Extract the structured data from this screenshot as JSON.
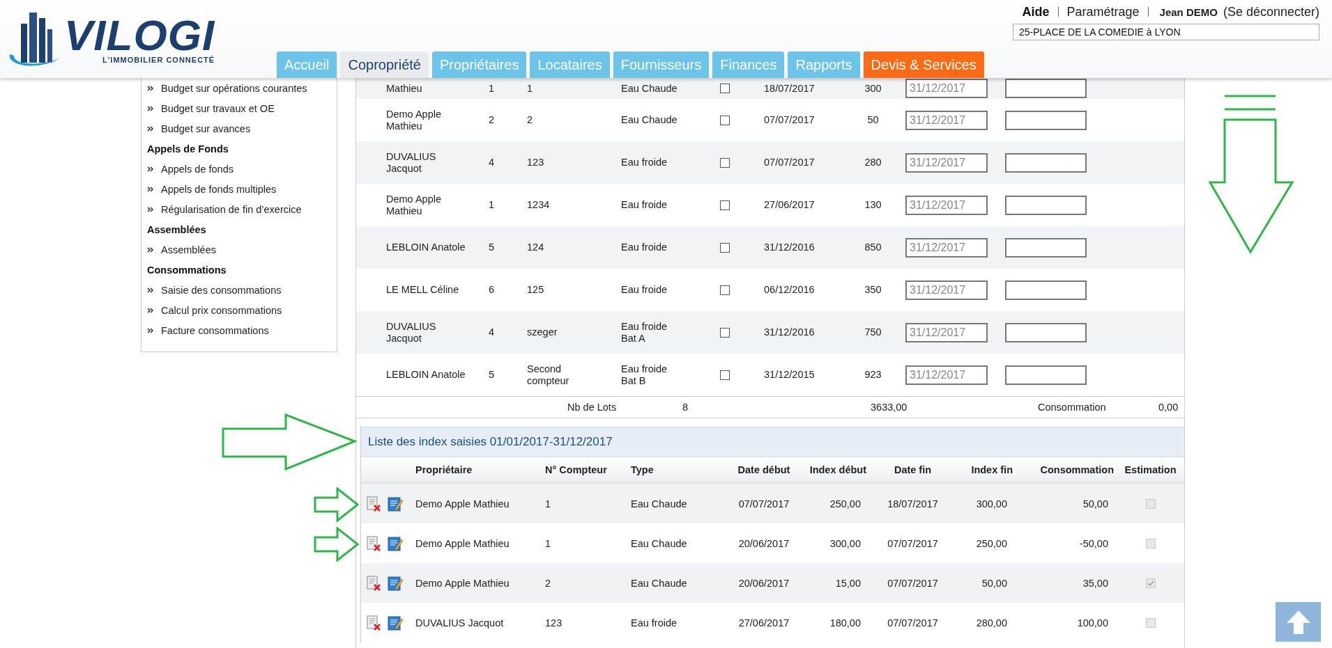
{
  "header": {
    "logo": {
      "name": "VILOGI",
      "tagline": "L'IMMOBILIER CONNECTÉ"
    },
    "links": [
      "Aide",
      "Paramétrage"
    ],
    "user": "Jean DEMO",
    "logout": "(Se déconnecter)",
    "address": "25-PLACE DE LA COMEDIE à LYON",
    "tabs": [
      {
        "label": "Accueil",
        "selected": false,
        "kind": "normal"
      },
      {
        "label": "Copropriété",
        "selected": true,
        "kind": "normal"
      },
      {
        "label": "Propriétaires",
        "selected": false,
        "kind": "normal"
      },
      {
        "label": "Locataires",
        "selected": false,
        "kind": "normal"
      },
      {
        "label": "Fournisseurs",
        "selected": false,
        "kind": "normal"
      },
      {
        "label": "Finances",
        "selected": false,
        "kind": "normal"
      },
      {
        "label": "Rapports",
        "selected": false,
        "kind": "normal"
      },
      {
        "label": "Devis & Services",
        "selected": false,
        "kind": "highlight"
      }
    ]
  },
  "sidebar": {
    "items": [
      {
        "kind": "link",
        "label": "Budget sur opérations courantes"
      },
      {
        "kind": "link",
        "label": "Budget sur travaux et OE"
      },
      {
        "kind": "link",
        "label": "Budget sur avances"
      },
      {
        "kind": "heading",
        "label": "Appels de Fonds"
      },
      {
        "kind": "link",
        "label": "Appels de fonds"
      },
      {
        "kind": "link",
        "label": "Appels de fonds multiples"
      },
      {
        "kind": "link",
        "label": "Régularisation de fin d’exercice"
      },
      {
        "kind": "heading",
        "label": "Assemblées"
      },
      {
        "kind": "link",
        "label": "Assemblées"
      },
      {
        "kind": "heading",
        "label": "Consommations"
      },
      {
        "kind": "link",
        "label": "Saisie des consommations"
      },
      {
        "kind": "link",
        "label": "Calcul prix consommations"
      },
      {
        "kind": "link",
        "label": "Facture consommations"
      }
    ]
  },
  "readings": {
    "rows": [
      {
        "name": "Mathieu",
        "lot": "1",
        "meter": "1",
        "type": "Eau Chaude",
        "checked": false,
        "date": "18/07/2017",
        "index": "300",
        "end_date_placeholder": "31/12/2017"
      },
      {
        "name": "Demo Apple\nMathieu",
        "lot": "2",
        "meter": "2",
        "type": "Eau Chaude",
        "checked": false,
        "date": "07/07/2017",
        "index": "50",
        "end_date_placeholder": "31/12/2017"
      },
      {
        "name": "DUVALIUS\nJacquot",
        "lot": "4",
        "meter": "123",
        "type": "Eau froide",
        "checked": false,
        "date": "07/07/2017",
        "index": "280",
        "end_date_placeholder": "31/12/2017"
      },
      {
        "name": "Demo Apple\nMathieu",
        "lot": "1",
        "meter": "1234",
        "type": "Eau froide",
        "checked": false,
        "date": "27/06/2017",
        "index": "130",
        "end_date_placeholder": "31/12/2017"
      },
      {
        "name": "LEBLOIN Anatole",
        "lot": "5",
        "meter": "124",
        "type": "Eau froide",
        "checked": false,
        "date": "31/12/2016",
        "index": "850",
        "end_date_placeholder": "31/12/2017"
      },
      {
        "name": "LE MELL Céline",
        "lot": "6",
        "meter": "125",
        "type": "Eau froide",
        "checked": false,
        "date": "06/12/2016",
        "index": "350",
        "end_date_placeholder": "31/12/2017"
      },
      {
        "name": "DUVALIUS\nJacquot",
        "lot": "4",
        "meter": "szeger",
        "type": "Eau froide\nBat A",
        "checked": false,
        "date": "31/12/2016",
        "index": "750",
        "end_date_placeholder": "31/12/2017"
      },
      {
        "name": "LEBLOIN Anatole",
        "lot": "5",
        "meter": "Second\ncompteur",
        "type": "Eau froide\nBat B",
        "checked": false,
        "date": "31/12/2015",
        "index": "923",
        "end_date_placeholder": "31/12/2017"
      }
    ],
    "footer": {
      "lots_label": "Nb de Lots",
      "lots": "8",
      "total": "3633,00",
      "consumption_label": "Consommation",
      "consumption": "0,00"
    }
  },
  "index_list": {
    "title": "Liste des index saisies 01/01/2017-31/12/2017",
    "columns": [
      "Propriétaire",
      "N° Compteur",
      "Type",
      "Date début",
      "Index début",
      "Date fin",
      "Index fin",
      "Consommation",
      "Estimation"
    ],
    "rows": [
      {
        "owner": "Demo Apple Mathieu",
        "meter": "1",
        "type": "Eau Chaude",
        "start_date": "07/07/2017",
        "start_index": "250,00",
        "end_date": "18/07/2017",
        "end_index": "300,00",
        "consumption": "50,00",
        "estimation": false
      },
      {
        "owner": "Demo Apple Mathieu",
        "meter": "1",
        "type": "Eau Chaude",
        "start_date": "20/06/2017",
        "start_index": "300,00",
        "end_date": "07/07/2017",
        "end_index": "250,00",
        "consumption": "-50,00",
        "estimation": false
      },
      {
        "owner": "Demo Apple Mathieu",
        "meter": "2",
        "type": "Eau Chaude",
        "start_date": "20/06/2017",
        "start_index": "15,00",
        "end_date": "07/07/2017",
        "end_index": "50,00",
        "consumption": "35,00",
        "estimation": true
      },
      {
        "owner": "DUVALIUS Jacquot",
        "meter": "123",
        "type": "Eau froide",
        "start_date": "27/06/2017",
        "start_index": "180,00",
        "end_date": "07/07/2017",
        "end_index": "280,00",
        "consumption": "100,00",
        "estimation": false
      }
    ]
  }
}
